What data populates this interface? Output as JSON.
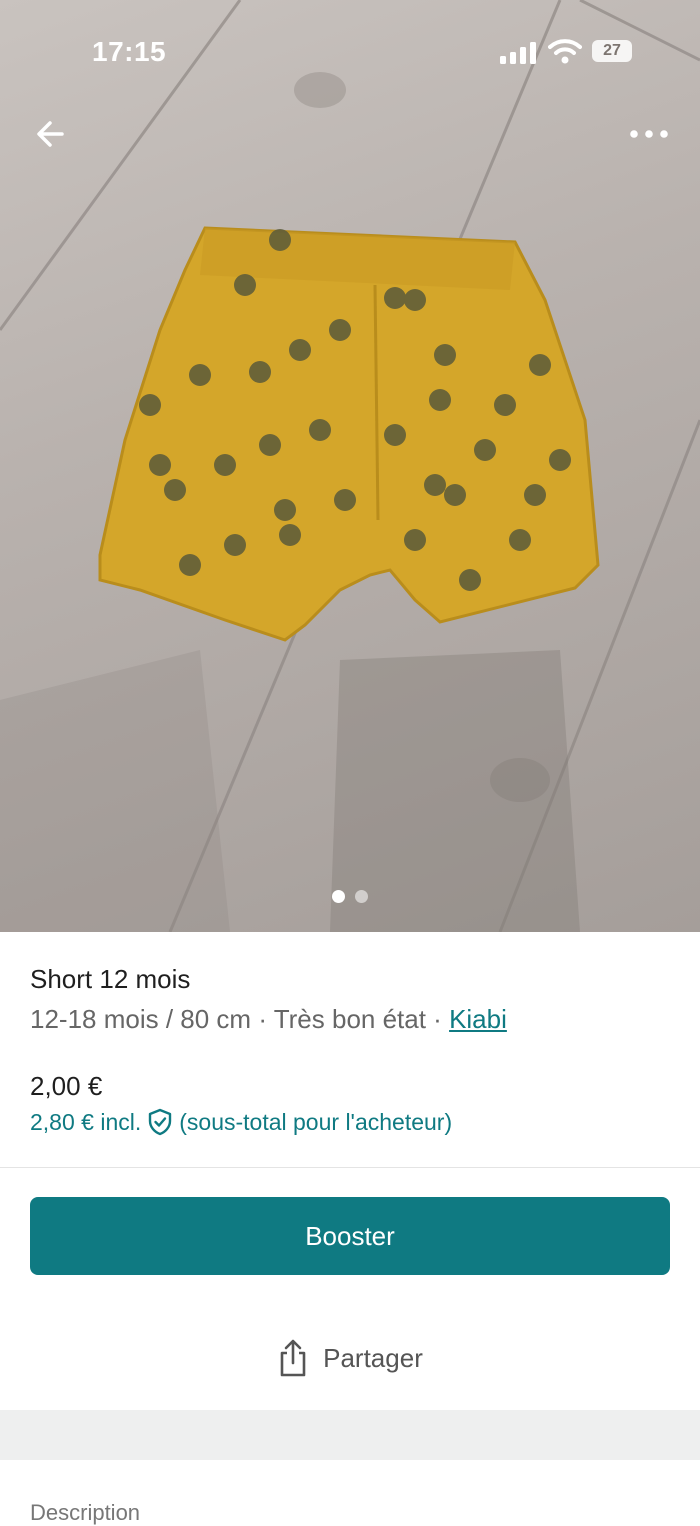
{
  "status_bar": {
    "time": "17:15",
    "battery": "27",
    "icons": [
      "signal-icon",
      "wifi-icon",
      "battery-icon"
    ]
  },
  "photo": {
    "nav_icons": [
      "back-icon",
      "more-icon"
    ],
    "carousel_pages": 2,
    "carousel_active": 1
  },
  "item": {
    "title": "Short 12 mois",
    "meta": "12-18 mois / 80 cm · Très bon état · ",
    "brand": "Kiabi",
    "price": "2,00 €",
    "price_incl": "2,80 € incl.",
    "price_incl_note": "(sous-total pour l'acheteur)"
  },
  "actions": {
    "booster_label": "Booster",
    "share_label": "Partager"
  },
  "sections": {
    "description_label": "Description"
  },
  "colors": {
    "accent": "#0f7a82",
    "shorts": "#d4a62a"
  }
}
